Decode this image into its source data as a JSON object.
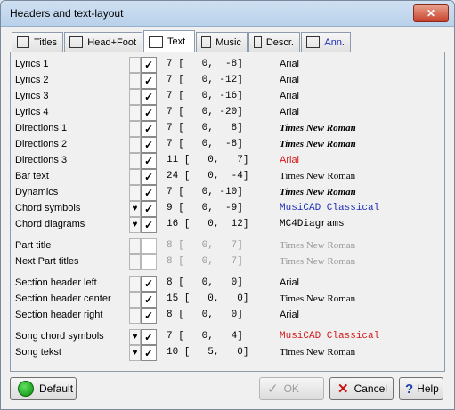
{
  "window": {
    "title": "Headers and text-layout"
  },
  "tabs": [
    {
      "label": "Titles",
      "icon": "titles-icon"
    },
    {
      "label": "Head+Foot",
      "icon": "headfoot-icon"
    },
    {
      "label": "Text",
      "icon": "text-icon",
      "active": true
    },
    {
      "label": "Music",
      "icon": "music-icon"
    },
    {
      "label": "Descr.",
      "icon": "descr-icon"
    },
    {
      "label": "Ann.",
      "icon": "ann-icon"
    }
  ],
  "rows": [
    {
      "label": "Lyrics 1",
      "heart": false,
      "checked": true,
      "enabled": true,
      "nums": "7 [   0,  -8]",
      "font": "Arial",
      "style": "sans"
    },
    {
      "label": "Lyrics 2",
      "heart": false,
      "checked": true,
      "enabled": true,
      "nums": "7 [   0, -12]",
      "font": "Arial",
      "style": "sans"
    },
    {
      "label": "Lyrics 3",
      "heart": false,
      "checked": true,
      "enabled": true,
      "nums": "7 [   0, -16]",
      "font": "Arial",
      "style": "sans"
    },
    {
      "label": "Lyrics 4",
      "heart": false,
      "checked": true,
      "enabled": true,
      "nums": "7 [   0, -20]",
      "font": "Arial",
      "style": "sans"
    },
    {
      "label": "Directions 1",
      "heart": false,
      "checked": true,
      "enabled": true,
      "nums": "7 [   0,   8]",
      "font": "Times New Roman",
      "style": "serif-bi"
    },
    {
      "label": "Directions 2",
      "heart": false,
      "checked": true,
      "enabled": true,
      "nums": "7 [   0,  -8]",
      "font": "Times New Roman",
      "style": "serif-bi"
    },
    {
      "label": "Directions 3",
      "heart": false,
      "checked": true,
      "enabled": true,
      "nums": "11 [   0,   7]",
      "font": "Arial",
      "style": "sans-red"
    },
    {
      "label": "Bar text",
      "heart": false,
      "checked": true,
      "enabled": true,
      "nums": "24 [   0,  -4]",
      "font": "Times New Roman",
      "style": "serif"
    },
    {
      "label": "Dynamics",
      "heart": false,
      "checked": true,
      "enabled": true,
      "nums": "7 [   0, -10]",
      "font": "Times New Roman",
      "style": "serif-bi"
    },
    {
      "label": "Chord symbols",
      "heart": true,
      "checked": true,
      "enabled": true,
      "nums": "9 [   0,  -9]",
      "font": "MusiCAD Classical",
      "style": "mono-blue"
    },
    {
      "label": "Chord diagrams",
      "heart": true,
      "checked": true,
      "enabled": true,
      "nums": "16 [   0,  12]",
      "font": "MC4Diagrams",
      "style": "mono"
    },
    {
      "label": "Part title",
      "heart": false,
      "checked": false,
      "enabled": false,
      "nums": "8 [   0,   7]",
      "font": "Times New Roman",
      "style": "serif-gray",
      "gap": true
    },
    {
      "label": "Next Part titles",
      "heart": false,
      "checked": false,
      "enabled": false,
      "nums": "8 [   0,   7]",
      "font": "Times New Roman",
      "style": "serif-gray"
    },
    {
      "label": "Section header left",
      "heart": false,
      "checked": true,
      "enabled": true,
      "nums": "8 [   0,   0]",
      "font": "Arial",
      "style": "sans",
      "gap": true
    },
    {
      "label": "Section header center",
      "heart": false,
      "checked": true,
      "enabled": true,
      "nums": "15 [   0,   0]",
      "font": "Times New Roman",
      "style": "serif"
    },
    {
      "label": "Section header right",
      "heart": false,
      "checked": true,
      "enabled": true,
      "nums": "8 [   0,   0]",
      "font": "Arial",
      "style": "sans"
    },
    {
      "label": "Song chord symbols",
      "heart": true,
      "checked": true,
      "enabled": true,
      "nums": "7 [   0,   4]",
      "font": "MusiCAD Classical",
      "style": "mono-red",
      "gap": true
    },
    {
      "label": "Song tekst",
      "heart": true,
      "checked": true,
      "enabled": true,
      "nums": "10 [   5,   0]",
      "font": "Times New Roman",
      "style": "serif"
    }
  ],
  "glyphs": {
    "check": "✓",
    "heart": "♥"
  },
  "buttons": {
    "default_label": "Default",
    "ok_label": "OK",
    "cancel_label": "Cancel",
    "help_label": "Help"
  }
}
